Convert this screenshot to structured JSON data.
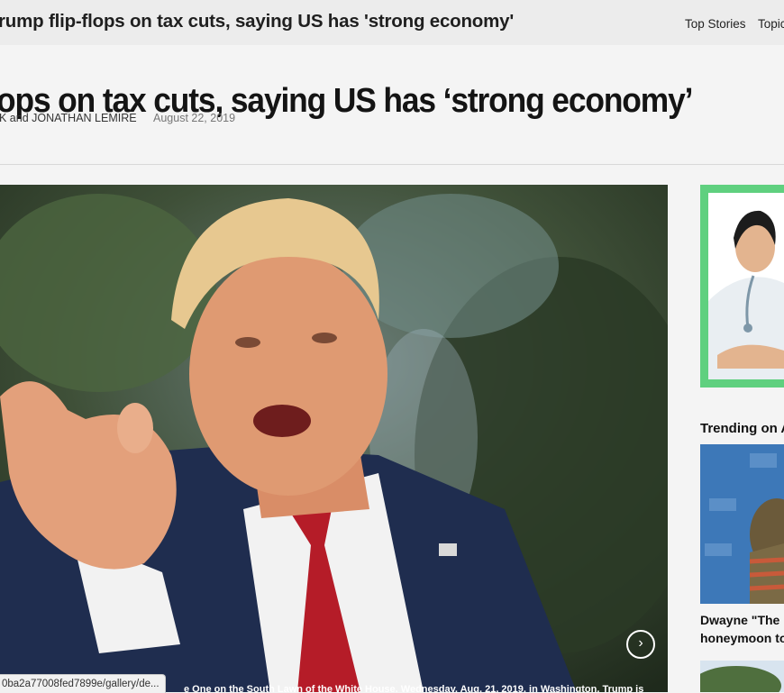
{
  "topbar": {
    "title": "rump flip-flops on tax cuts, saying US has 'strong economy'",
    "nav": [
      "Top Stories",
      "Topic"
    ]
  },
  "article": {
    "headline": "ops on tax cuts, saying US has ‘strong economy’",
    "byline": "K and JONATHAN LEMIRE",
    "date": "August 22, 2019",
    "caption": "e One on the South Lawn of the White House, Wednesday, Aug. 21, 2019, in Washington. Trump is"
  },
  "status_bar": {
    "url": "0ba2a77008fed7899e/gallery/de..."
  },
  "sidebar": {
    "ad_accent": "#5fd07f",
    "trending_heading": "Trending on AP",
    "trending_item": {
      "caption_line1": "Dwayne \"The R",
      "caption_line2": "honeymoon to"
    }
  },
  "icons": {
    "next": "chevron-right-icon"
  }
}
